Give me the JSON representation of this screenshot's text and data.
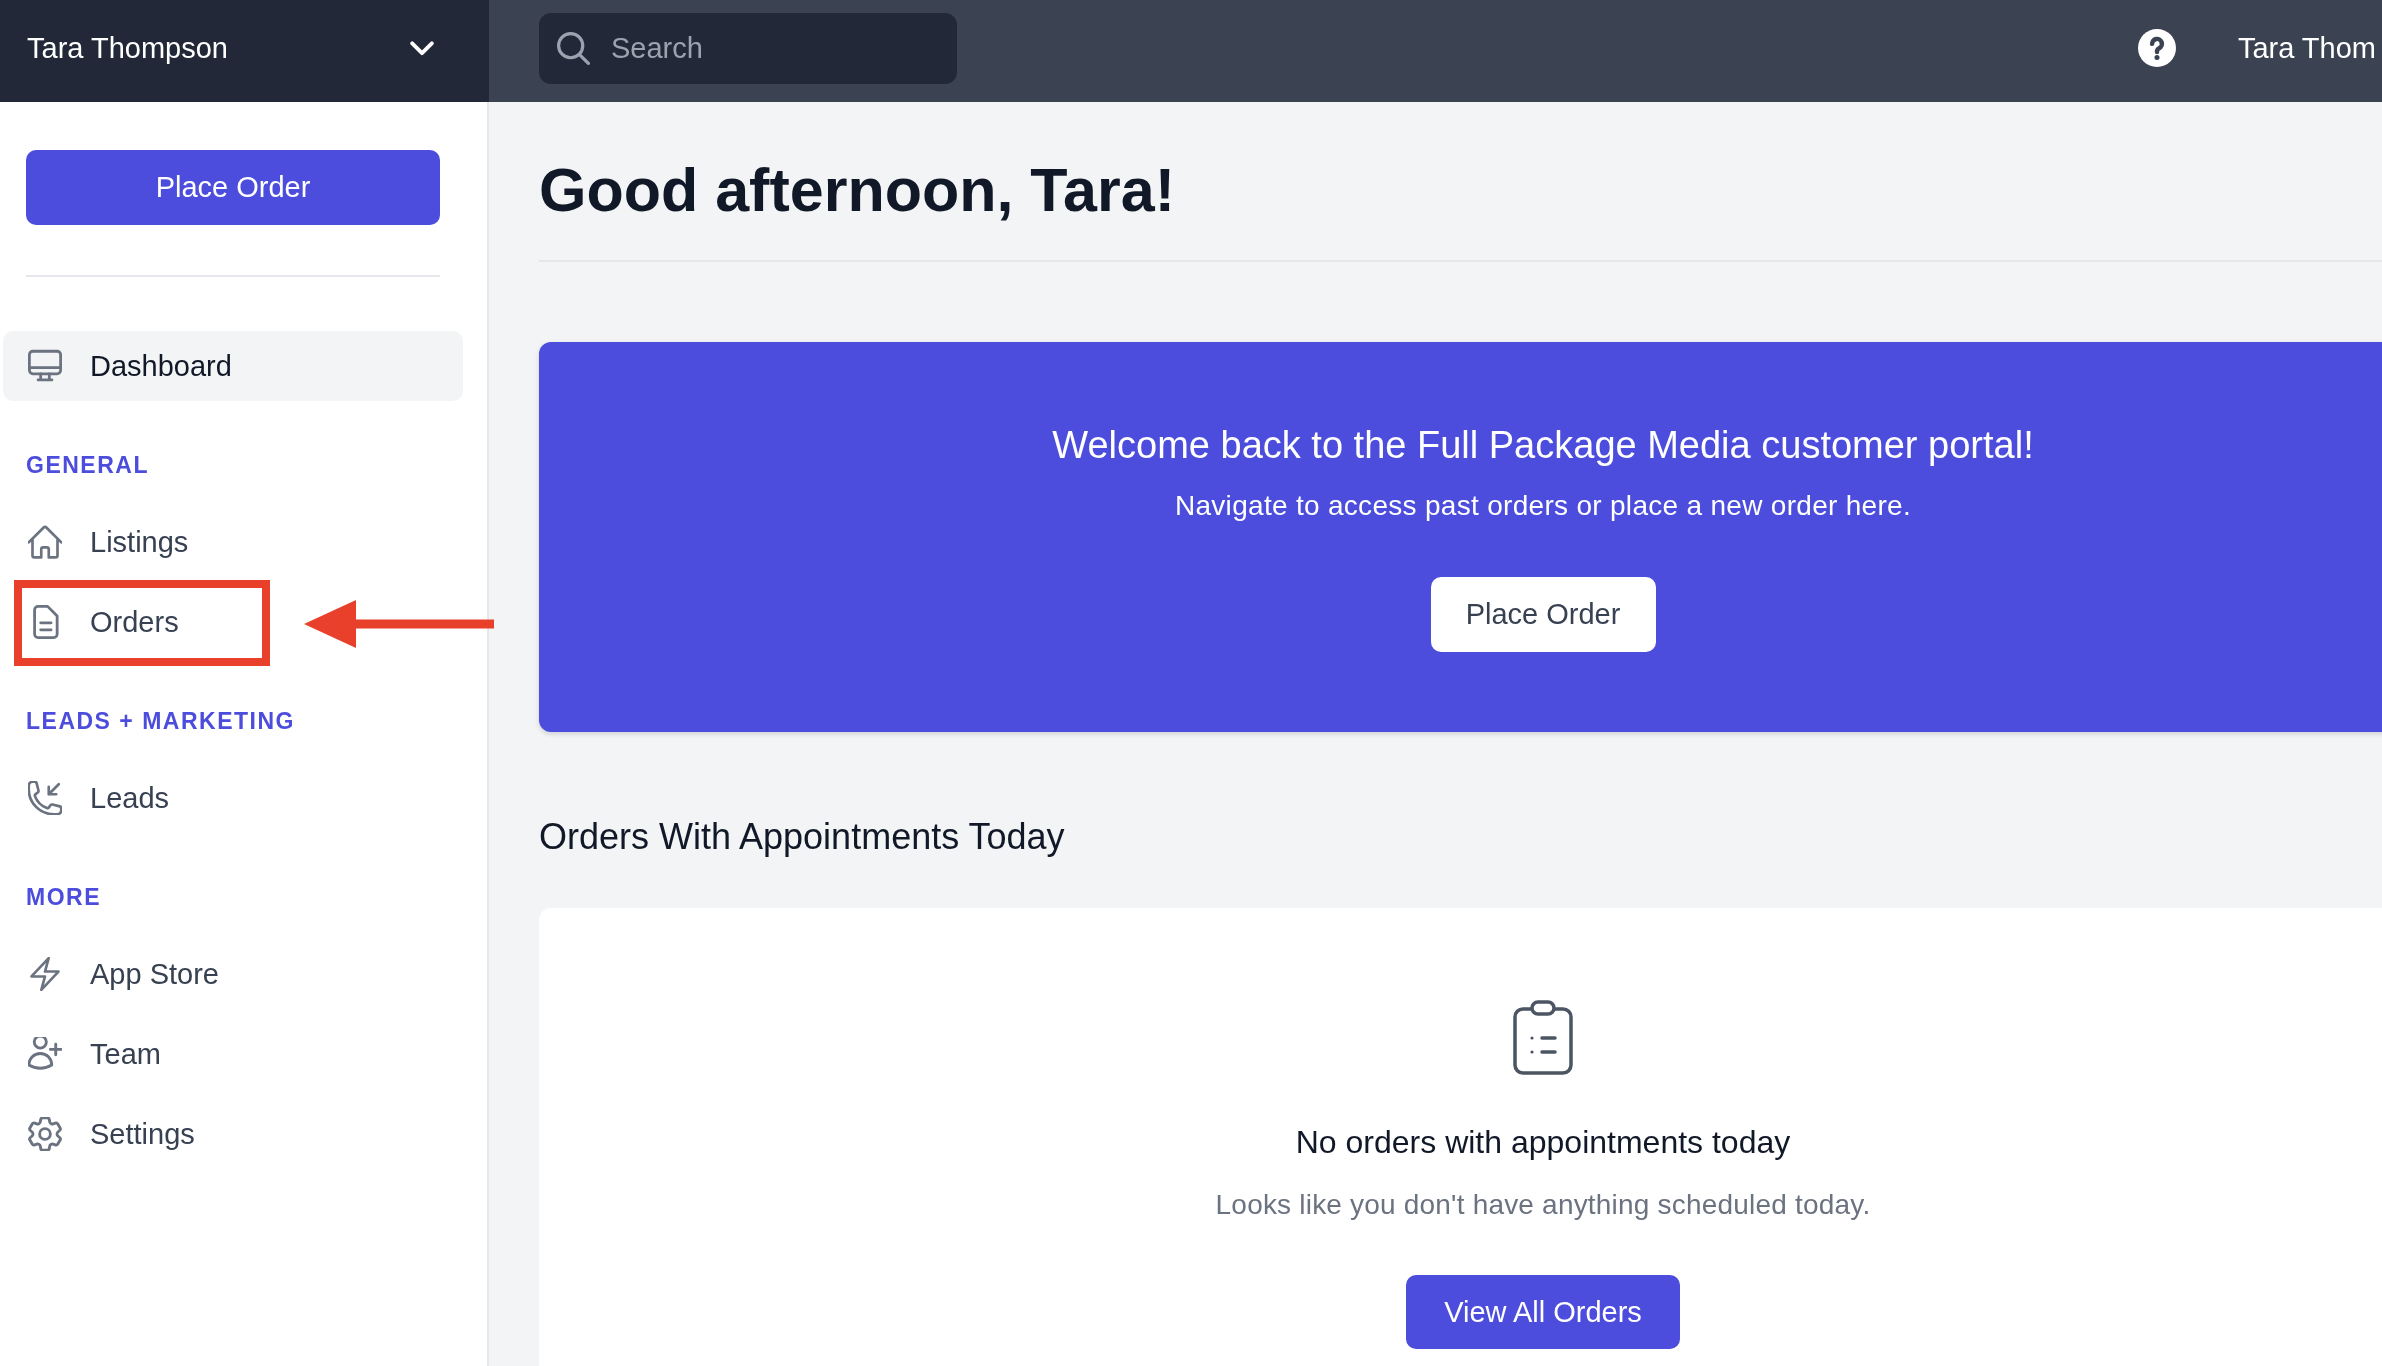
{
  "account_menu": {
    "name": "Tara Thompson"
  },
  "search": {
    "placeholder": "Search"
  },
  "user_menu": {
    "name": "Tara Thom"
  },
  "sidebar": {
    "primary_button": "Place Order",
    "top_items": [
      {
        "label": "Dashboard",
        "selected": true,
        "annotated": false
      }
    ],
    "groups": [
      {
        "title": "GENERAL",
        "items": [
          {
            "label": "Listings",
            "selected": false,
            "annotated": false
          },
          {
            "label": "Orders",
            "selected": false,
            "annotated": true
          }
        ]
      },
      {
        "title": "LEADS + MARKETING",
        "items": [
          {
            "label": "Leads",
            "selected": false,
            "annotated": false
          }
        ]
      },
      {
        "title": "MORE",
        "items": [
          {
            "label": "App Store",
            "selected": false,
            "annotated": false
          },
          {
            "label": "Team",
            "selected": false,
            "annotated": false
          },
          {
            "label": "Settings",
            "selected": false,
            "annotated": false
          }
        ]
      }
    ]
  },
  "main": {
    "greeting": "Good afternoon, Tara!",
    "banner": {
      "title": "Welcome back to the Full Package Media customer portal!",
      "subtitle": "Navigate to access past orders or place a new order here.",
      "button": "Place Order"
    },
    "section_title": "Orders With Appointments Today",
    "empty_state": {
      "title": "No orders with appointments today",
      "message": "Looks like you don't have anything scheduled today.",
      "button": "View All Orders"
    }
  }
}
